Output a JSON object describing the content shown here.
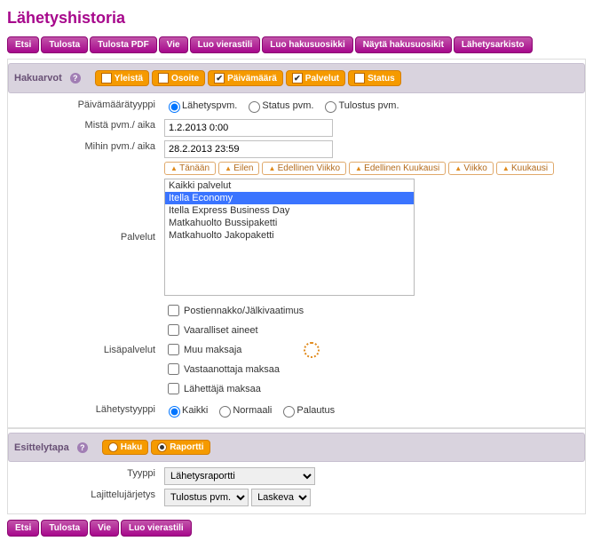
{
  "title": "Lähetyshistoria",
  "top_buttons": [
    "Etsi",
    "Tulosta",
    "Tulosta PDF",
    "Vie",
    "Luo vierastili",
    "Luo hakusuosikki",
    "Näytä hakusuosikit",
    "Lähetysarkisto"
  ],
  "section_hakuarvot": "Hakuarvot",
  "tabs": [
    {
      "label": "Yleistä",
      "checked": false,
      "type": "box"
    },
    {
      "label": "Osoite",
      "checked": false,
      "type": "box"
    },
    {
      "label": "Päivämäärä",
      "checked": true,
      "type": "box"
    },
    {
      "label": "Palvelut",
      "checked": true,
      "type": "box"
    },
    {
      "label": "Status",
      "checked": false,
      "type": "box"
    }
  ],
  "labels": {
    "pvm_tyyppi": "Päivämäärätyyppi",
    "mista": "Mistä pvm./ aika",
    "mihin": "Mihin pvm./ aika",
    "palvelut": "Palvelut",
    "lisapalvelut": "Lisäpalvelut",
    "lahetystyyppi": "Lähetystyyppi",
    "tyyppi": "Tyyppi",
    "lajittelu": "Lajittelujärjetys"
  },
  "pvm_radio": {
    "options": [
      "Lähetyspvm.",
      "Status pvm.",
      "Tulostus pvm."
    ],
    "selected": 0
  },
  "mista_val": "1.2.2013 0:00",
  "mihin_val": "28.2.2013 23:59",
  "quick": [
    "Tänään",
    "Eilen",
    "Edellinen Viikko",
    "Edellinen Kuukausi",
    "Viikko",
    "Kuukausi"
  ],
  "services": {
    "options": [
      "Kaikki palvelut",
      "Itella Economy",
      "Itella Express Business Day",
      "Matkahuolto Bussipaketti",
      "Matkahuolto Jakopaketti"
    ],
    "selected": 1
  },
  "lisap": [
    "Postiennakko/Jälkivaatimus",
    "Vaaralliset aineet",
    "Muu maksaja",
    "Vastaanottaja maksaa",
    "Lähettäjä maksaa"
  ],
  "ltyyppi": {
    "options": [
      "Kaikki",
      "Normaali",
      "Palautus"
    ],
    "selected": 0
  },
  "section_esittely": "Esittelytapa",
  "view_tabs": [
    {
      "label": "Haku",
      "on": false
    },
    {
      "label": "Raportti",
      "on": true
    }
  ],
  "tyyppi_val": "Lähetysraportti",
  "sort_field": "Tulostus pvm.",
  "sort_dir": "Laskeva",
  "bottom_buttons": [
    "Etsi",
    "Tulosta",
    "Vie",
    "Luo vierastili"
  ]
}
